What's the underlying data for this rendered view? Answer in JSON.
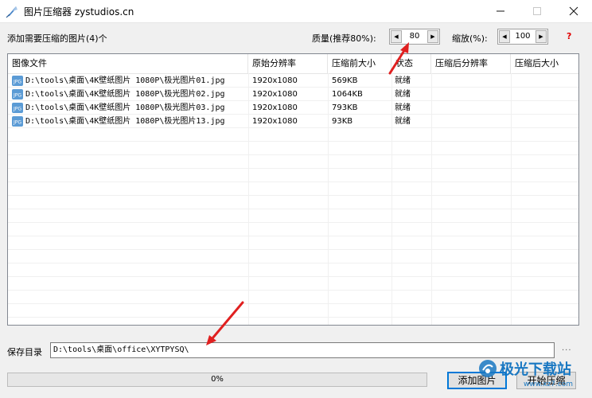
{
  "window": {
    "title": "图片压缩器 zystudios.cn"
  },
  "toolbar": {
    "file_count_label": "添加需要压缩的图片(4)个",
    "quality_label": "质量(推荐80%):",
    "quality_value": "80",
    "scale_label": "缩放(%):",
    "scale_value": "100",
    "help_label": "?"
  },
  "table": {
    "columns": [
      "图像文件",
      "原始分辨率",
      "压缩前大小",
      "状态",
      "压缩后分辨率",
      "压缩后大小"
    ],
    "rows": [
      [
        "D:\\tools\\桌面\\4K壁纸图片 1080P\\极光图片01.jpg",
        "1920x1080",
        "569KB",
        "就绪",
        "",
        ""
      ],
      [
        "D:\\tools\\桌面\\4K壁纸图片 1080P\\极光图片02.jpg",
        "1920x1080",
        "1064KB",
        "就绪",
        "",
        ""
      ],
      [
        "D:\\tools\\桌面\\4K壁纸图片 1080P\\极光图片03.jpg",
        "1920x1080",
        "793KB",
        "就绪",
        "",
        ""
      ],
      [
        "D:\\tools\\桌面\\4K壁纸图片 1080P\\极光图片13.jpg",
        "1920x1080",
        "93KB",
        "就绪",
        "",
        ""
      ]
    ]
  },
  "save": {
    "label": "保存目录",
    "path": "D:\\tools\\桌面\\office\\XYTPYSQ\\",
    "browse_label": "..."
  },
  "progress": {
    "value": 0,
    "text": "0%"
  },
  "buttons": {
    "add_images": "添加图片",
    "start_compress": "开始压缩"
  },
  "watermark": {
    "text": "极光下载站",
    "url": "www.xz7.com"
  },
  "colors": {
    "annotation_arrow": "#e02020",
    "progress_fill": "#06b025",
    "help_mark": "#e00000",
    "focus_border": "#0078d7"
  }
}
